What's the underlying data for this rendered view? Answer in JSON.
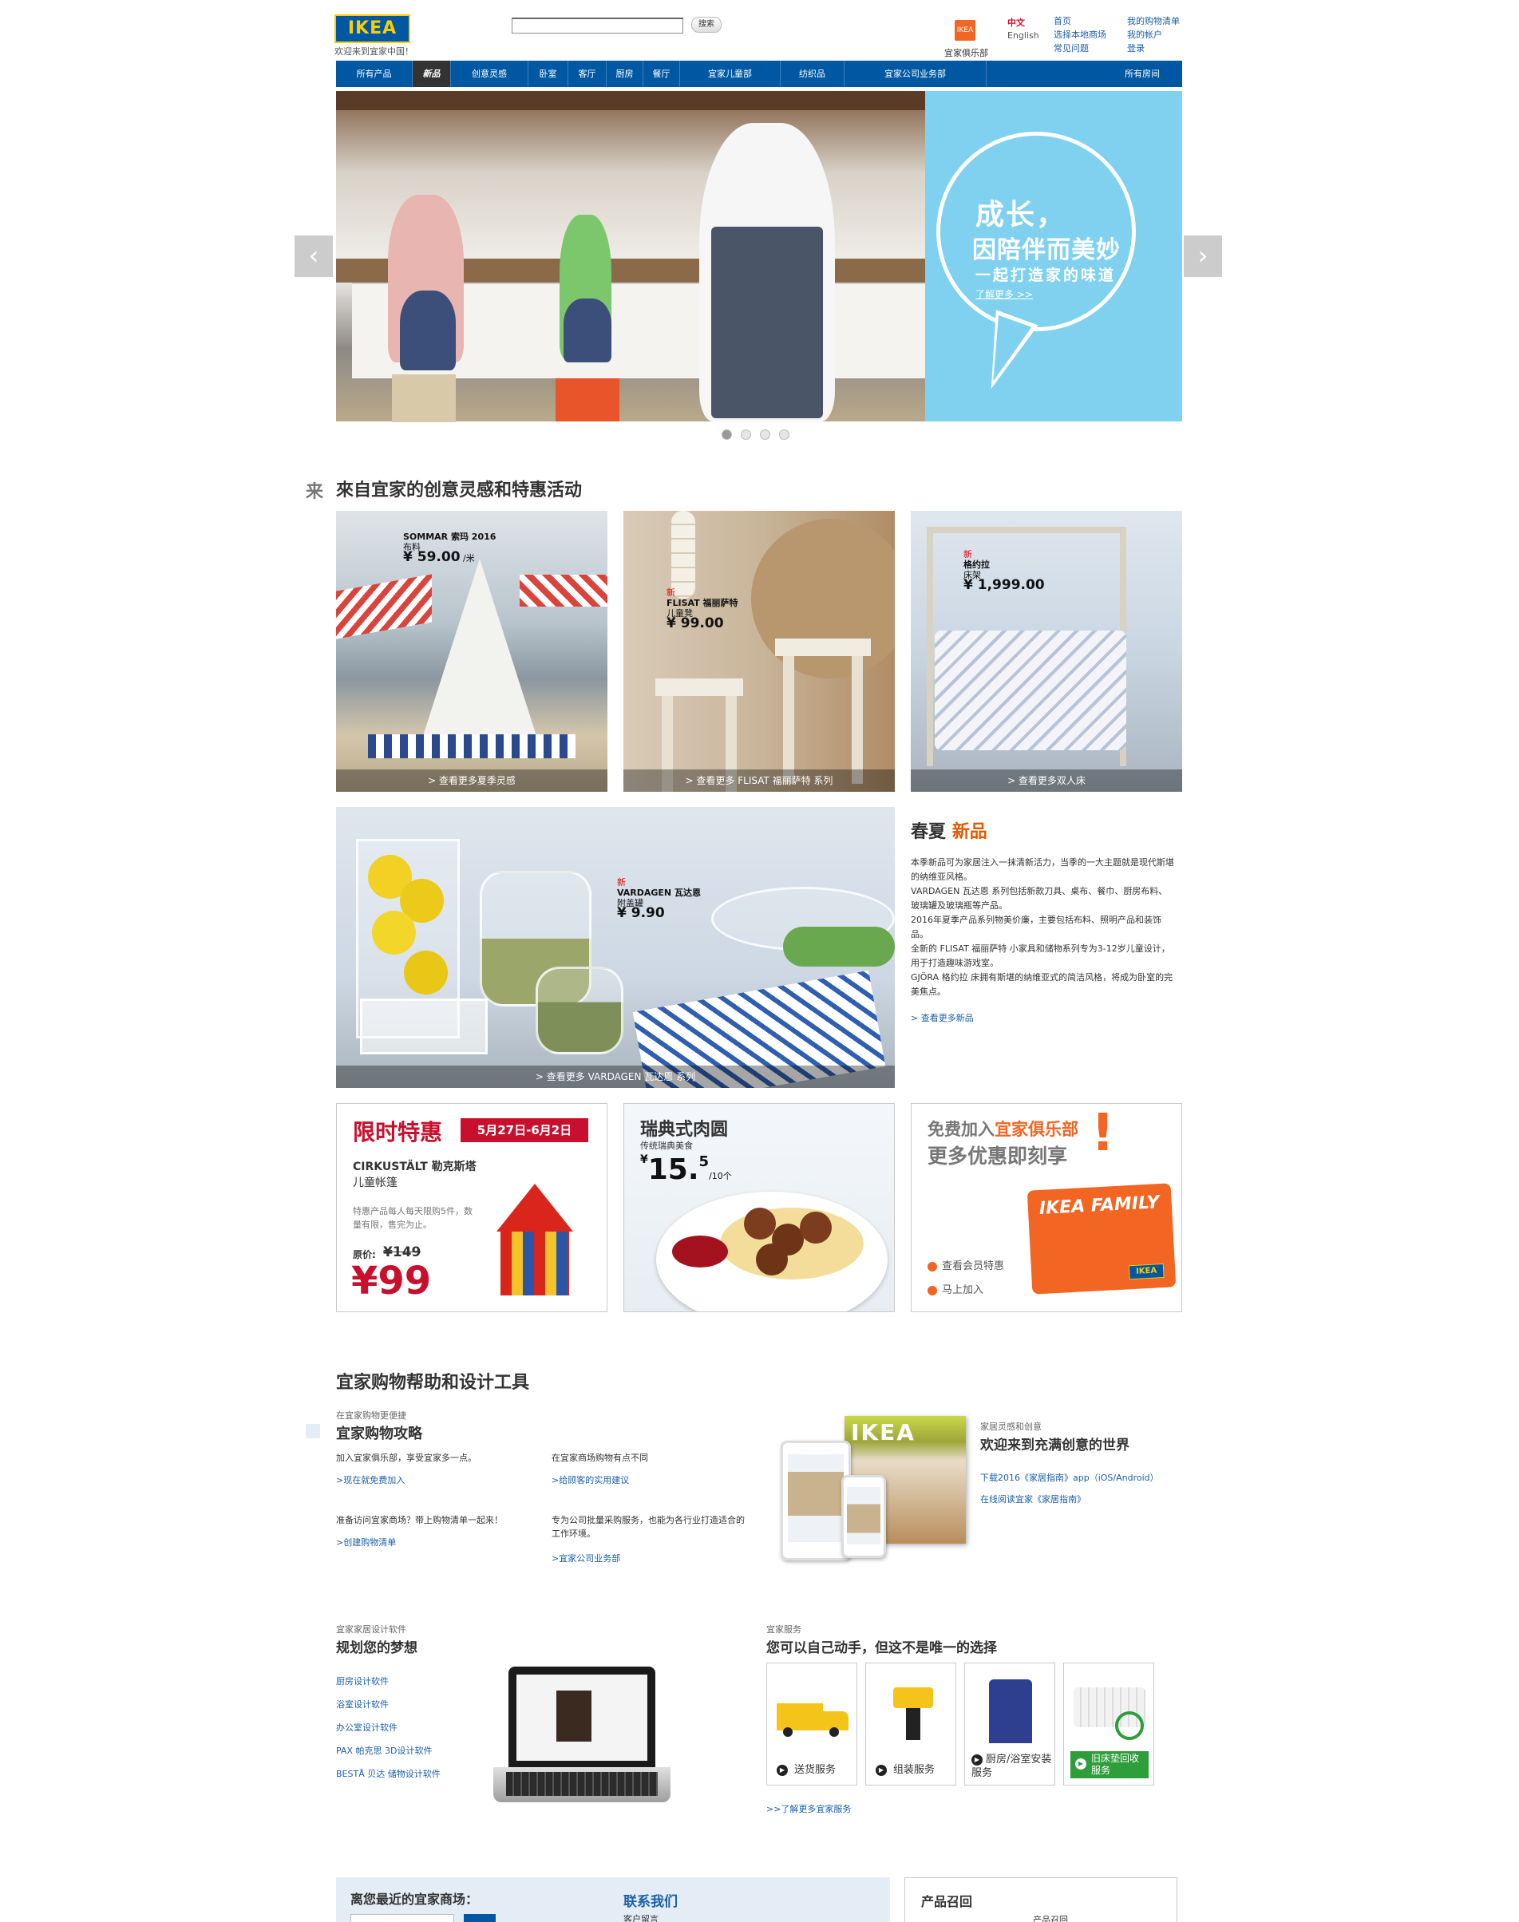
{
  "header": {
    "logo_text": "IKEA",
    "welcome": "欢迎来到宜家中国！",
    "search_button": "搜索",
    "search_value": "",
    "club_label": "宜家俱乐部",
    "lang_active": "中文",
    "lang_other": "English",
    "links_col1": [
      "首页",
      "选择本地商场",
      "常见问题"
    ],
    "links_col2": [
      "我的购物清单",
      "我的帐户",
      "登录"
    ]
  },
  "nav": {
    "items": [
      "所有产品",
      "新品",
      "创意灵感",
      "卧室",
      "客厅",
      "厨房",
      "餐厅",
      "宜家儿童部",
      "纺织品",
      "宜家公司业务部",
      "所有房间"
    ],
    "active_index": 1
  },
  "hero": {
    "line1": "成长，",
    "line2": "因陪伴而美妙",
    "line3": "一起打造家的味道",
    "link": "了解更多 >>",
    "prev_icon": "‹",
    "next_icon": "›",
    "slide_count": 4,
    "active_slide": 0
  },
  "inspiration": {
    "title_mark": "来",
    "title": "來自宜家的创意灵感和特惠活动",
    "tiles": [
      {
        "name": "SOMMAR 索玛 2016",
        "type": "布料",
        "price": "¥ 59.00",
        "unit": "/米",
        "new": "",
        "caption": "> 查看更多夏季灵感"
      },
      {
        "name": "FLISAT 福丽萨特",
        "type": "儿童凳",
        "price": "¥ 99.00",
        "unit": "",
        "new": "新",
        "caption": "> 查看更多 FLISAT 福丽萨特 系列"
      },
      {
        "name": "格约拉",
        "type": "床架",
        "price": "¥ 1,999.00",
        "unit": "",
        "new": "新",
        "caption": "> 查看更多双人床"
      }
    ],
    "wide": {
      "name": "VARDAGEN 瓦达恩",
      "type": "附盖罐",
      "price": "¥ 9.90",
      "new": "新",
      "caption": "> 查看更多 VARDAGEN 瓦达恩 系列"
    },
    "spring": {
      "title_a": "春夏",
      "title_b": "新品",
      "paras": [
        "本季新品可为家居注入一抹清新活力，当季的一大主题就是现代斯堪的纳维亚风格。",
        "VARDAGEN 瓦达恩 系列包括新款刀具、桌布、餐巾、厨房布料、玻璃罐及玻璃瓶等产品。",
        "2016年夏季产品系列物美价廉，主要包括布料、照明产品和装饰品。",
        "全新的 FLISAT 福丽萨特 小家具和储物系列专为3-12岁儿童设计，用于打造趣味游戏室。",
        "GJÖRA 格约拉 床拥有斯堪的纳维亚式的简洁风格，将成为卧室的完美焦点。"
      ],
      "link": "> 查看更多新品"
    }
  },
  "promos": {
    "deal": {
      "title": "限时特惠",
      "date": "5月27日-6月2日",
      "product": "CIRKUSTÄLT 勒克斯塔",
      "type": "儿童帐篷",
      "note": "特惠产品每人每天限购5件，数量有限，售完为止。",
      "orig_label": "原价:",
      "orig_price": "¥149",
      "price": "¥99"
    },
    "meatball": {
      "title": "瑞典式肉圆",
      "sub": "传统瑞典美食",
      "currency": "¥",
      "price_int": "15.",
      "price_dec": "5",
      "unit": "/10个"
    },
    "family": {
      "line1a": "免费加入",
      "line1b": "宜家俱乐部",
      "line2": "更多优惠即刻享",
      "excl": "!",
      "card_text": "IKEA FAMILY",
      "card_logo": "IKEA",
      "link1": "查看会员特惠",
      "link2": "马上加入"
    }
  },
  "help": {
    "title": "宜家购物帮助和设计工具",
    "eyebrow": "在宜家购物更便捷",
    "subtitle": "宜家购物攻略",
    "items": [
      {
        "text": "加入宜家俱乐部，享受宜家多一点。",
        "link": ">现在就免费加入"
      },
      {
        "text": "在宜家商场购物有点不同",
        "link": ">给顾客的实用建议"
      },
      {
        "text": "准备访问宜家商场？带上购物清单一起来！",
        "link": ">创建购物清单"
      },
      {
        "text": "专为公司批量采购服务，也能为各行业打造适合的工作环境。",
        "link": ">宜家公司业务部"
      }
    ],
    "catalog": {
      "eyebrow": "家居灵感和创意",
      "title": "欢迎来到充满创意的世界",
      "link1": "下载2016《家居指南》app（iOS/Android）",
      "link2": "在线阅读宜家《家居指南》",
      "cover_text": "IKEA"
    }
  },
  "design": {
    "eyebrow": "宜家家居设计软件",
    "title": "规划您的梦想",
    "links": [
      "厨房设计软件",
      "浴室设计软件",
      "办公室设计软件",
      "PAX 帕克思 3D设计软件",
      "BESTÅ 贝达 储物设计软件"
    ]
  },
  "services": {
    "eyebrow": "宜家服务",
    "title": "您可以自己动手，但这不是唯一的选择",
    "items": [
      "送货服务",
      "组装服务",
      "厨房/浴室安装服务",
      "旧床垫回收服务"
    ],
    "link": ">>了解更多宜家服务"
  },
  "footer": {
    "store": "离您最近的宜家商场：",
    "contact": "联系我们",
    "contact_sub": "客户留言",
    "recall": "产品召回",
    "recall_sub": "产品召回"
  },
  "colors": {
    "ikea_blue": "#0058a3",
    "ikea_yellow": "#ffcc00",
    "accent_red": "#c8102e",
    "orange": "#f26522"
  }
}
